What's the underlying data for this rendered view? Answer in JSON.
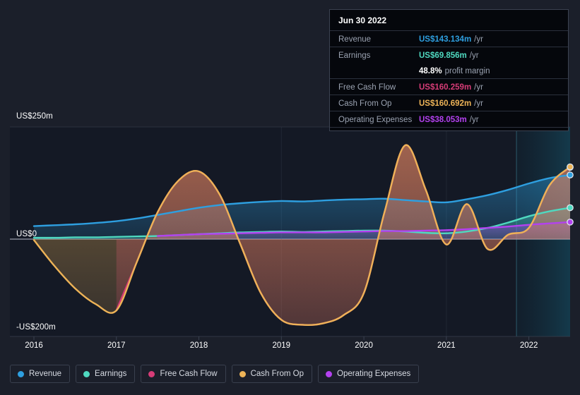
{
  "colors": {
    "background": "#1b1f2a",
    "plot_background": "#141925",
    "forecast_band": "#123040",
    "revenue": "#2e9fe0",
    "earnings": "#4fd9c0",
    "free_cash_flow": "#d63c77",
    "cash_from_op": "#edb357",
    "operating_expenses": "#b341ef",
    "grid": "#3a4150",
    "zero_line": "#a8aebb",
    "axis_text": "#ffffff",
    "tooltip_bg": "#05070c",
    "tooltip_border": "#3b4251",
    "tooltip_key": "#9aa2b1"
  },
  "tooltip": {
    "date": "Jun 30 2022",
    "rows": [
      {
        "key": "Revenue",
        "value": "US$143.134m",
        "unit": "/yr",
        "color": "#2e9fe0"
      },
      {
        "key": "Earnings",
        "value": "US$69.856m",
        "unit": "/yr",
        "color": "#4fd9c0"
      },
      {
        "key": "Free Cash Flow",
        "value": "US$160.259m",
        "unit": "/yr",
        "color": "#d63c77"
      },
      {
        "key": "Cash From Op",
        "value": "US$160.692m",
        "unit": "/yr",
        "color": "#edb357"
      },
      {
        "key": "Operating Expenses",
        "value": "US$38.053m",
        "unit": "/yr",
        "color": "#b341ef"
      }
    ],
    "profit_margin_value": "48.8%",
    "profit_margin_label": "profit margin"
  },
  "legend": {
    "items": [
      {
        "label": "Revenue",
        "color": "#2e9fe0"
      },
      {
        "label": "Earnings",
        "color": "#4fd9c0"
      },
      {
        "label": "Free Cash Flow",
        "color": "#d63c77"
      },
      {
        "label": "Cash From Op",
        "color": "#edb357"
      },
      {
        "label": "Operating Expenses",
        "color": "#b341ef"
      }
    ]
  },
  "chart_data": {
    "type": "area",
    "title": "",
    "xlabel": "",
    "ylabel": "",
    "ylim": [
      -200,
      250
    ],
    "y_ticks": [
      {
        "value": 250,
        "label": "US$250m"
      },
      {
        "value": 0,
        "label": "US$0"
      },
      {
        "value": -200,
        "label": "-US$200m"
      }
    ],
    "grid": true,
    "legend_position": "bottom",
    "x": [
      2016.0,
      2016.25,
      2016.5,
      2016.75,
      2017.0,
      2017.25,
      2017.5,
      2017.75,
      2018.0,
      2018.25,
      2018.5,
      2018.75,
      2019.0,
      2019.25,
      2019.5,
      2019.75,
      2020.0,
      2020.25,
      2020.5,
      2020.75,
      2021.0,
      2021.25,
      2021.5,
      2021.75,
      2022.0,
      2022.25,
      2022.5
    ],
    "x_tick_labels": [
      "2016",
      "2017",
      "2018",
      "2019",
      "2020",
      "2021",
      "2022"
    ],
    "forecast_start": 2021.85,
    "series": [
      {
        "name": "Revenue",
        "color": "#2e9fe0",
        "values": [
          29,
          31,
          33,
          36,
          40,
          46,
          54,
          62,
          70,
          76,
          80,
          83,
          85,
          84,
          86,
          88,
          89,
          90,
          87,
          84,
          82,
          89,
          98,
          110,
          124,
          136,
          143
        ]
      },
      {
        "name": "Earnings",
        "color": "#4fd9c0",
        "values": [
          3,
          3,
          4,
          4,
          5,
          6,
          7,
          9,
          11,
          13,
          15,
          16,
          17,
          16,
          17,
          18,
          19,
          19,
          17,
          14,
          13,
          17,
          25,
          37,
          51,
          62,
          70
        ]
      },
      {
        "name": "Free Cash Flow",
        "color": "#d63c77",
        "values": [
          null,
          null,
          null,
          null,
          -159,
          -50,
          60,
          130,
          151,
          100,
          -10,
          -120,
          -180,
          -191,
          -188,
          -170,
          -120,
          60,
          209,
          110,
          -12,
          78,
          -22,
          10,
          25,
          120,
          160
        ]
      },
      {
        "name": "Cash From Op",
        "color": "#edb357",
        "values": [
          -2,
          -60,
          -110,
          -145,
          -159,
          -50,
          60,
          130,
          151,
          100,
          -10,
          -120,
          -180,
          -191,
          -188,
          -170,
          -120,
          60,
          209,
          110,
          -12,
          78,
          -22,
          10,
          25,
          120,
          161
        ]
      },
      {
        "name": "Operating Expenses",
        "color": "#b341ef",
        "values": [
          null,
          null,
          null,
          null,
          null,
          null,
          7,
          9,
          11,
          12,
          13,
          14,
          15,
          15,
          15,
          16,
          17,
          18,
          18,
          19,
          20,
          22,
          25,
          28,
          32,
          35,
          38
        ]
      }
    ]
  }
}
